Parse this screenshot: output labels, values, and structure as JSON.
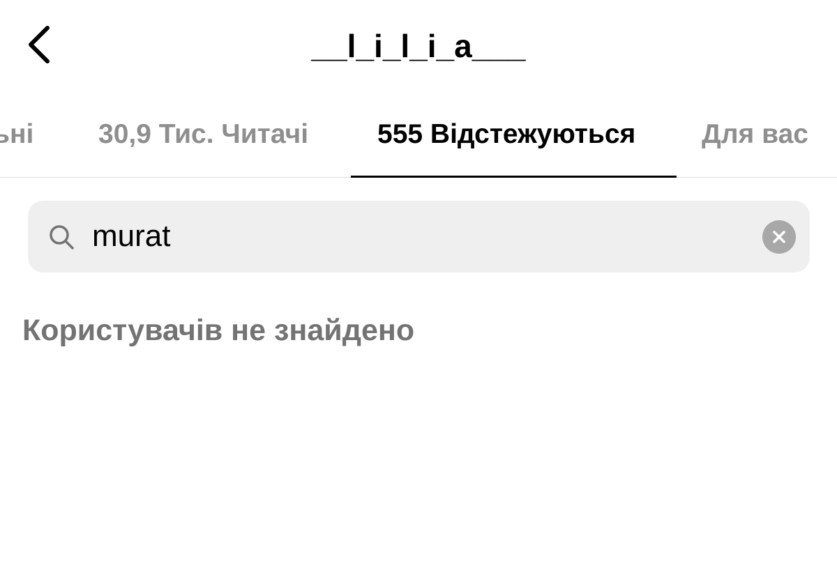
{
  "header": {
    "title": "__l_i_l_i_a___",
    "back_icon": "chevron-left-icon"
  },
  "tabs": [
    {
      "label": "ьні",
      "active": false
    },
    {
      "label": "30,9 Тис. Читачі",
      "active": false
    },
    {
      "label": "555 Відстежуються",
      "active": true
    },
    {
      "label": "Для вас",
      "active": false
    }
  ],
  "search": {
    "value": "murat",
    "icon": "search-icon",
    "clear_icon": "clear-icon"
  },
  "results": {
    "empty_message": "Користувачів не знайдено"
  },
  "colors": {
    "active_text": "#000000",
    "inactive_text": "#8e8e8e",
    "search_bg": "#efefef",
    "empty_text": "#737373"
  }
}
